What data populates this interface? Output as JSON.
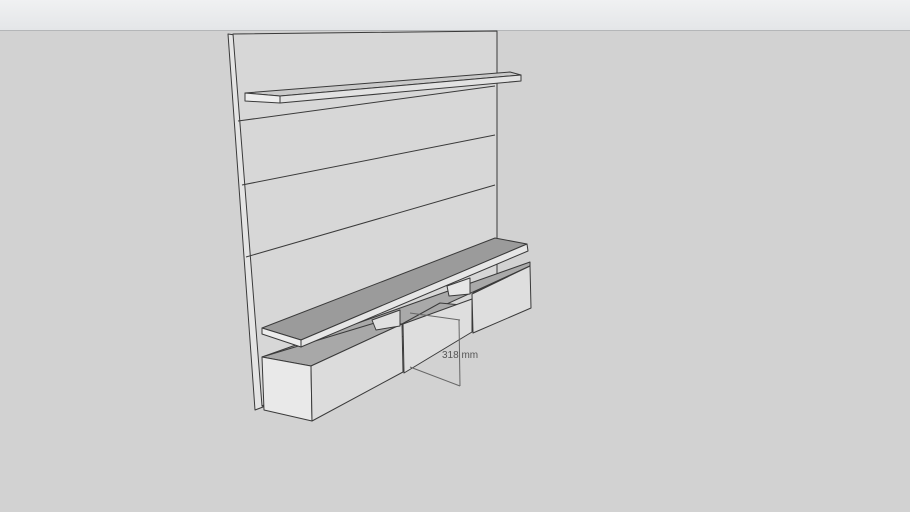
{
  "viewport": {
    "dimension_label": "318 mm"
  },
  "colors": {
    "background": "#d2d2d2",
    "panel_face": "#d6d6d6",
    "shelf_top": "#999999",
    "edge": "#3a3a3a",
    "dimension": "#666666"
  }
}
